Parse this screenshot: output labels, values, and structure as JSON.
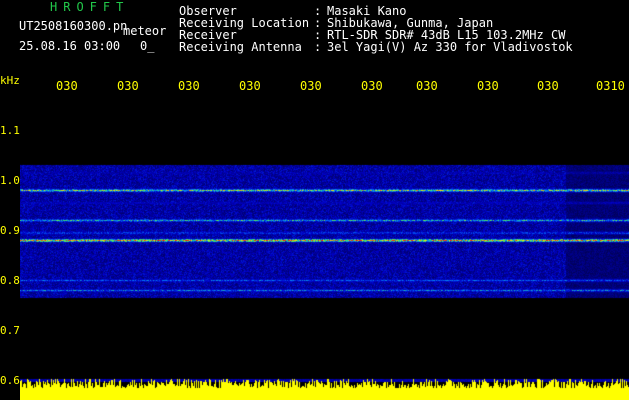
{
  "header": {
    "title": "HROFFT",
    "file_name": "UT2508160300.pn",
    "mode": "meteor",
    "date_time": "25.08.16 03:00",
    "misc": "0_",
    "observer_label": "Observer",
    "observer_value": "Masaki Kano",
    "location_label": "Receiving Location",
    "location_value": "Shibukawa, Gunma, Japan",
    "receiver_label": "Receiver",
    "receiver_value": "RTL-SDR SDR# 43dB L15 103.2MHz CW",
    "antenna_label": "Receiving Antenna",
    "antenna_value": "3el Yagi(V) Az 330 for Vladivostok",
    "separator": ":"
  },
  "freq_axis": {
    "unit": "kHz",
    "labels": [
      "1.1",
      "1.0",
      "0.9",
      "0.8",
      "0.7",
      "0.6"
    ]
  },
  "time_axis": {
    "labels": [
      "030",
      "030",
      "030",
      "030",
      "030",
      "030",
      "030",
      "030",
      "030",
      "0310"
    ]
  },
  "colors": {
    "background": "#000000",
    "plot_background": "#000080",
    "text": "#ffffff",
    "title": "#22c84a",
    "axis": "#ffff00"
  },
  "spectrogram": {
    "freq_range_khz": [
      0.6,
      1.15
    ],
    "band_center_freqs_khz": [
      1.015,
      0.98,
      0.955,
      0.92,
      0.895,
      0.88,
      0.8,
      0.78
    ],
    "band_intensity": [
      0.35,
      0.85,
      0.4,
      0.7,
      0.55,
      1.0,
      0.55,
      0.6
    ]
  }
}
